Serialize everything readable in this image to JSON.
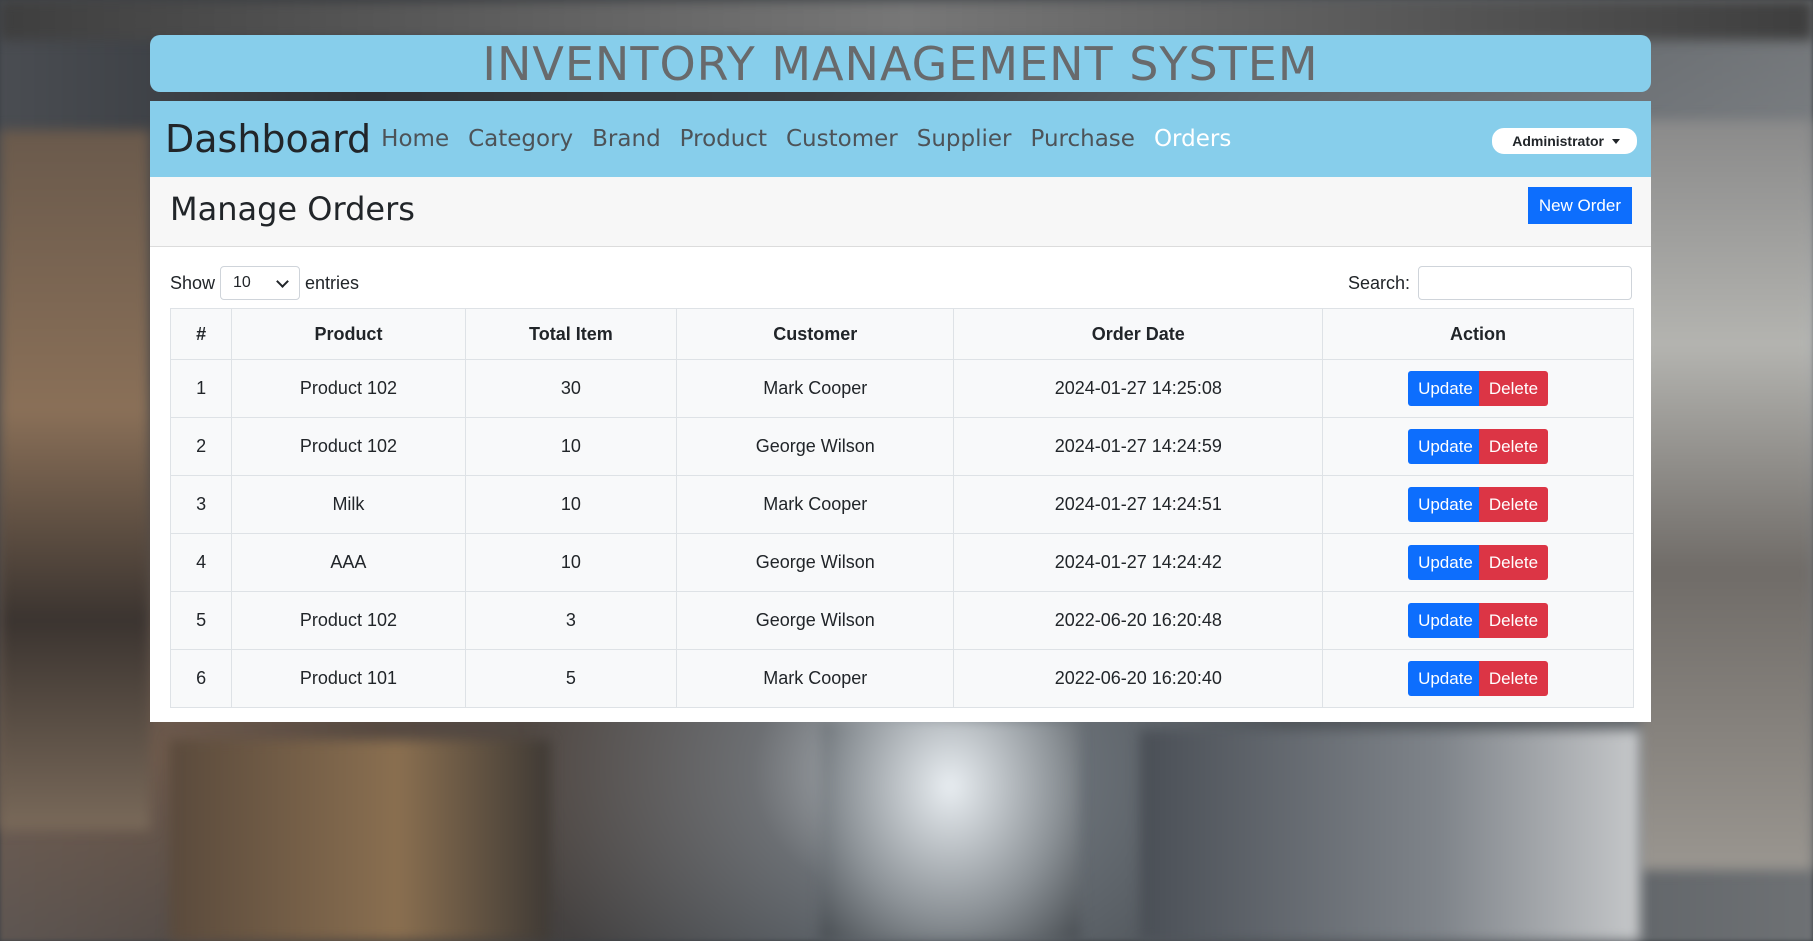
{
  "app": {
    "title": "INVENTORY MANAGEMENT SYSTEM"
  },
  "nav": {
    "brand": "Dashboard",
    "links": [
      "Home",
      "Category",
      "Brand",
      "Product",
      "Customer",
      "Supplier",
      "Purchase",
      "Orders"
    ],
    "active": "Orders",
    "user_menu": "Administrator"
  },
  "page": {
    "title": "Manage Orders",
    "new_button": "New Order"
  },
  "table_controls": {
    "show_label": "Show",
    "page_size": "10",
    "entries_label": "entries",
    "search_label": "Search:",
    "search_value": ""
  },
  "table": {
    "columns": [
      "#",
      "Product",
      "Total Item",
      "Customer",
      "Order Date",
      "Action"
    ],
    "rows": [
      {
        "num": "1",
        "product": "Product 102",
        "total": "30",
        "customer": "Mark Cooper",
        "date": "2024-01-27 14:25:08"
      },
      {
        "num": "2",
        "product": "Product 102",
        "total": "10",
        "customer": "George Wilson",
        "date": "2024-01-27 14:24:59"
      },
      {
        "num": "3",
        "product": "Milk",
        "total": "10",
        "customer": "Mark Cooper",
        "date": "2024-01-27 14:24:51"
      },
      {
        "num": "4",
        "product": "AAA",
        "total": "10",
        "customer": "George Wilson",
        "date": "2024-01-27 14:24:42"
      },
      {
        "num": "5",
        "product": "Product 102",
        "total": "3",
        "customer": "George Wilson",
        "date": "2022-06-20 16:20:48"
      },
      {
        "num": "6",
        "product": "Product 101",
        "total": "5",
        "customer": "Mark Cooper",
        "date": "2022-06-20 16:20:40"
      }
    ],
    "update_label": "Update",
    "delete_label": "Delete"
  },
  "colors": {
    "header_bg": "#87ceeb",
    "primary": "#0d6efd",
    "danger": "#dc3545"
  }
}
